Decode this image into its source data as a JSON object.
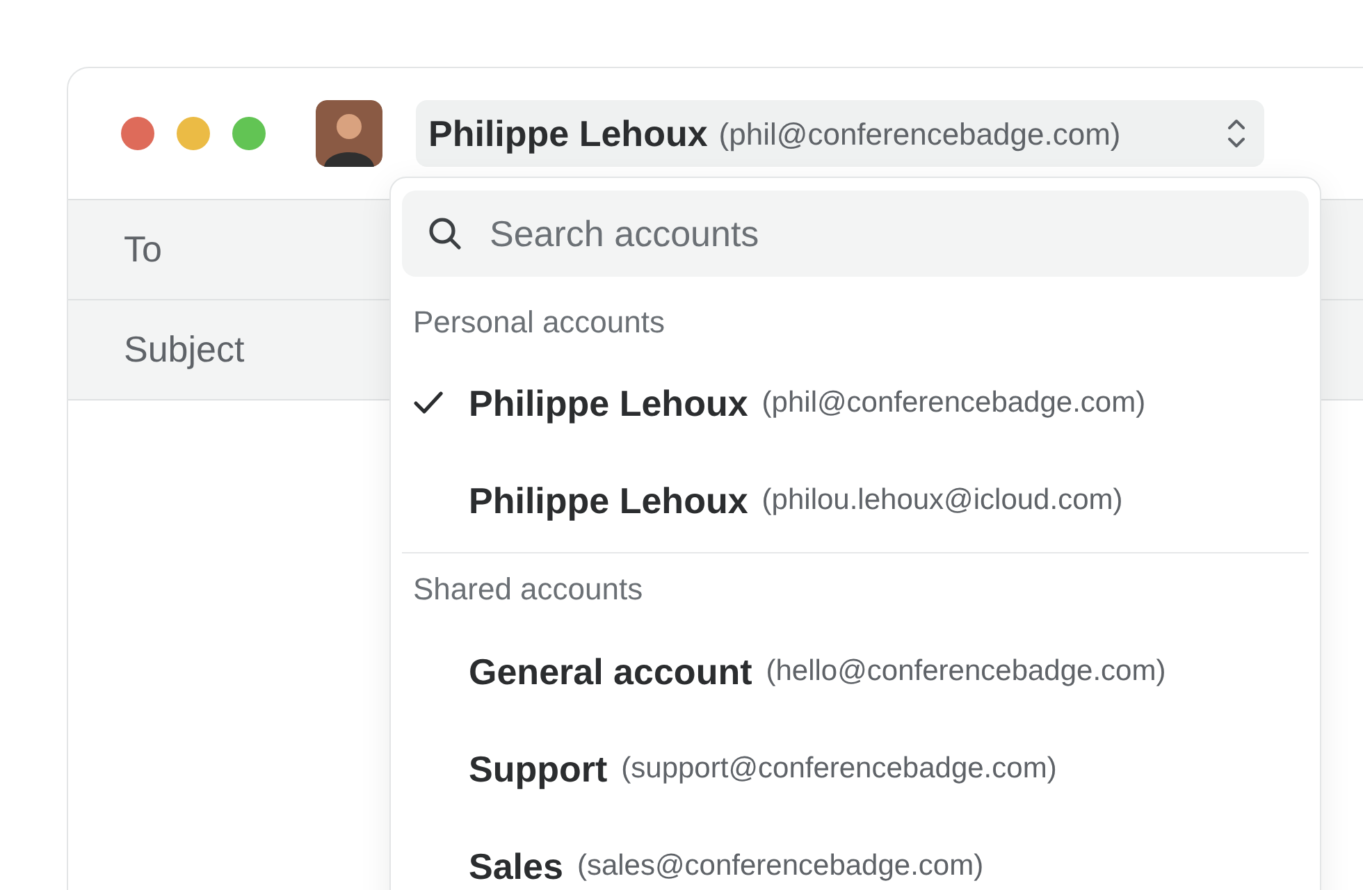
{
  "window": {
    "account_button": {
      "name": "Philippe Lehoux",
      "email": "(phil@conferencebadge.com)"
    },
    "fields": [
      {
        "label": "To"
      },
      {
        "label": "Subject"
      }
    ]
  },
  "account_menu": {
    "search": {
      "placeholder": "Search accounts"
    },
    "sections": [
      {
        "title": "Personal accounts",
        "accounts": [
          {
            "name": "Philippe Lehoux",
            "email": "(phil@conferencebadge.com)",
            "selected": true
          },
          {
            "name": "Philippe Lehoux",
            "email": "(philou.lehoux@icloud.com)",
            "selected": false
          }
        ]
      },
      {
        "title": "Shared accounts",
        "accounts": [
          {
            "name": "General account",
            "email": "(hello@conferencebadge.com)",
            "selected": false
          },
          {
            "name": "Support",
            "email": "(support@conferencebadge.com)",
            "selected": false
          },
          {
            "name": "Sales",
            "email": "(sales@conferencebadge.com)",
            "selected": false
          }
        ]
      }
    ]
  }
}
